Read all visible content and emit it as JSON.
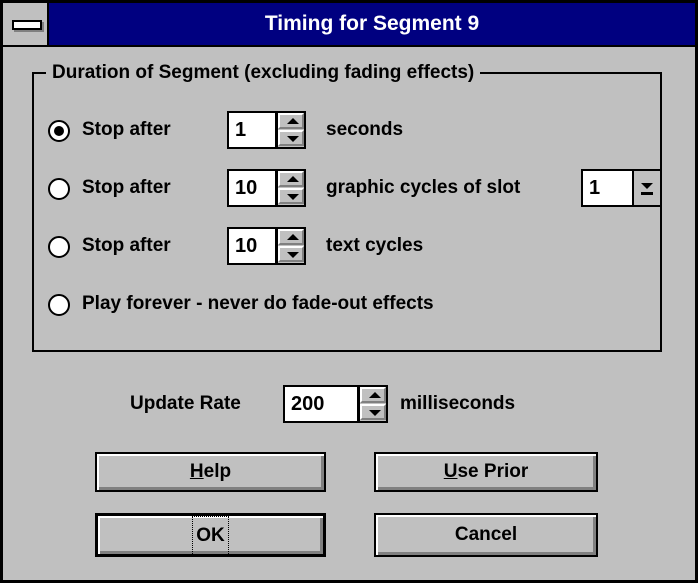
{
  "window": {
    "title": "Timing for Segment 9"
  },
  "group": {
    "legend": "Duration of Segment  (excluding fading effects)"
  },
  "options": [
    {
      "label": "Stop after",
      "value": "1",
      "unit": "seconds",
      "selected": true
    },
    {
      "label": "Stop after",
      "value": "10",
      "unit": "graphic cycles of slot",
      "slot": "1",
      "selected": false
    },
    {
      "label": "Stop after",
      "value": "10",
      "unit": "text cycles",
      "selected": false
    },
    {
      "label": "Play forever - never do fade-out effects",
      "selected": false
    }
  ],
  "update": {
    "label": "Update Rate",
    "value": "200",
    "unit": "milliseconds"
  },
  "buttons": {
    "help": {
      "mnemonic": "H",
      "rest": "elp"
    },
    "use_prior": {
      "mnemonic": "U",
      "rest": "se Prior"
    },
    "ok": "OK",
    "cancel": "Cancel"
  },
  "colors": {
    "titlebar": "#000080",
    "face": "#c0c0c0"
  }
}
